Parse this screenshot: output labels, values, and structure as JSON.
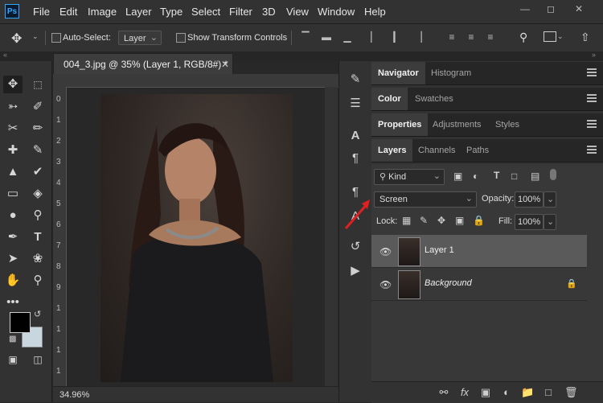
{
  "app": {
    "logo": "Ps"
  },
  "menu": [
    "File",
    "Edit",
    "Image",
    "Layer",
    "Type",
    "Select",
    "Filter",
    "3D",
    "View",
    "Window",
    "Help"
  ],
  "options_bar": {
    "auto_select_label": "Auto-Select:",
    "auto_select_value": "Layer",
    "show_transform_label": "Show Transform Controls"
  },
  "document": {
    "tab_title": "004_3.jpg @ 35% (Layer 1, RGB/8#) *",
    "zoom": "34.96%",
    "ruler_left": [
      "0",
      "1",
      "2",
      "3",
      "4",
      "5",
      "6",
      "7",
      "8",
      "9",
      "1",
      "1",
      "1",
      "1"
    ]
  },
  "panels": {
    "group1": [
      {
        "label": "Navigator",
        "active": true
      },
      {
        "label": "Histogram",
        "active": false
      }
    ],
    "group2": [
      {
        "label": "Color",
        "active": true
      },
      {
        "label": "Swatches",
        "active": false
      }
    ],
    "group3": [
      {
        "label": "Properties",
        "active": true
      },
      {
        "label": "Adjustments",
        "active": false
      },
      {
        "label": "Styles",
        "active": false
      }
    ],
    "group4": [
      {
        "label": "Layers",
        "active": true
      },
      {
        "label": "Channels",
        "active": false
      },
      {
        "label": "Paths",
        "active": false
      }
    ]
  },
  "layers_panel": {
    "filter_kind": "Kind",
    "blend_mode": "Screen",
    "opacity_label": "Opacity:",
    "opacity_value": "100%",
    "lock_label": "Lock:",
    "fill_label": "Fill:",
    "fill_value": "100%",
    "layers": [
      {
        "name": "Layer 1",
        "selected": true,
        "visible": true,
        "locked": false
      },
      {
        "name": "Background",
        "selected": false,
        "visible": true,
        "locked": true
      }
    ]
  },
  "colors": {
    "foreground": "#000000",
    "background": "#c8d6e0",
    "accent": "#31a8ff",
    "annotation_arrow": "#e02020"
  }
}
